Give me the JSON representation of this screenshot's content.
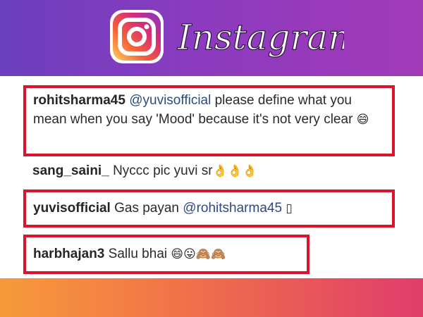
{
  "header": {
    "brand_name": "Instagram"
  },
  "comments": [
    {
      "user": "rohitsharma45",
      "mention": "@yuvisofficial",
      "text": "please define what you mean when you say 'Mood' because it's not very clear",
      "emoji": "😄",
      "highlighted": true
    },
    {
      "user": "sang_saini_",
      "text": "Nyccc pic yuvi sr",
      "emoji": "👌👌👌",
      "highlighted": false
    },
    {
      "user": "yuvisofficial",
      "text": "Gas payan",
      "mention": "@rohitsharma45",
      "emoji": "▯",
      "highlighted": true
    },
    {
      "user": "harbhajan3",
      "text": "Sallu bhai",
      "emoji": "😄😛🙈🙈",
      "highlighted": true
    }
  ],
  "colors": {
    "highlight_border": "#d9142b",
    "top_gradient": [
      "#6b3fbf",
      "#a23ab8"
    ],
    "bottom_gradient": [
      "#f79a3a",
      "#e03d6a"
    ]
  }
}
